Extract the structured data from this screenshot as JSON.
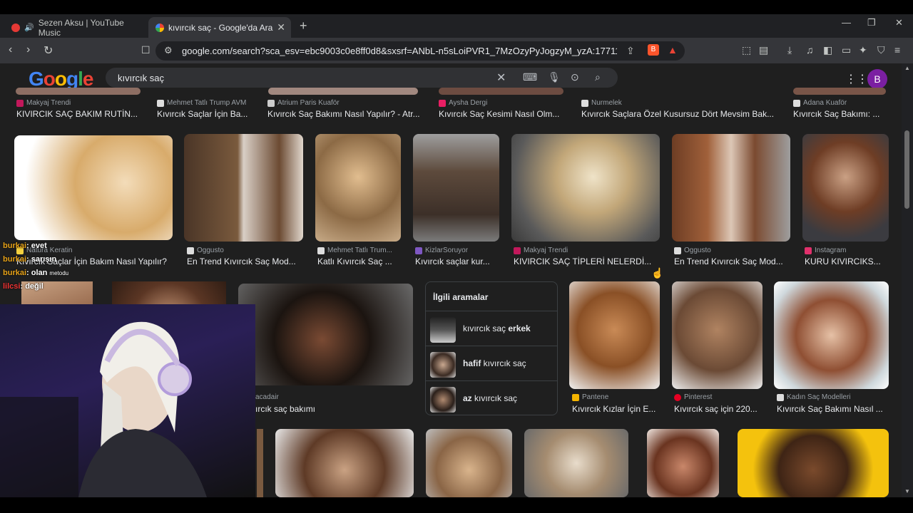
{
  "tabs": [
    {
      "label": "Sezen Aksu | YouTube Music",
      "active": false
    },
    {
      "label": "kıvırcık saç - Google'da Ara",
      "active": true
    }
  ],
  "address": {
    "url": "google.com/search?sca_esv=ebc9003c0e8ff0d8&sxsrf=ANbL-n5sLoiPVR1_7MzOzyPyJogzyM_yzA:1771197863048&u..."
  },
  "search": {
    "query": "kıvırcık saç",
    "logo": "Google"
  },
  "account": {
    "initial": "B"
  },
  "row1": [
    {
      "source": "Makyaj Trendi",
      "title": "KIVIRCIK SAÇ BAKIM RUTİN...",
      "fav": "#c2185b"
    },
    {
      "source": "Mehmet Tatlı Trump AVM",
      "title": "Kıvırcık Saçlar İçin Ba...",
      "fav": "#ddd"
    },
    {
      "source": "Atrium Paris Kuaför",
      "title": "Kıvırcık Saç Bakımı Nasıl Yapılır? - Atr...",
      "fav": "#ccc"
    },
    {
      "source": "Aysha Dergi",
      "title": "Kıvırcık Saç Kesimi Nasıl Olm...",
      "fav": "#e91e63"
    },
    {
      "source": "Nurmelek",
      "title": "Kıvırcık Saçlara Özel Kusursuz Dört Mevsim Bak...",
      "fav": "#ddd"
    },
    {
      "source": "Adana Kuaför",
      "title": "Kıvırcık Saç Bakımı: ...",
      "fav": "#ddd"
    }
  ],
  "row2": [
    {
      "source": "Natura Keratin",
      "title": "Kıvırcık Saçlar İçin Bakım Nasıl Yapılır?",
      "fav": "#f4d03f"
    },
    {
      "source": "Oggusto",
      "title": "En Trend Kıvırcık Saç Mod...",
      "fav": "#ddd"
    },
    {
      "source": "Mehmet Tatlı Trum...",
      "title": "Katlı Kıvırcık Saç ...",
      "fav": "#ddd"
    },
    {
      "source": "KizlarSoruyor",
      "title": "Kıvırcık saçlar kur...",
      "fav": "#7e57c2"
    },
    {
      "source": "Makyaj Trendi",
      "title": "KIVIRCIK SAÇ TİPLERİ NELERDİ...",
      "fav": "#c2185b"
    },
    {
      "source": "Oggusto",
      "title": "En Trend Kıvırcık Saç Mod...",
      "fav": "#ddd"
    },
    {
      "source": "Instagram",
      "title": "KURU KIVIRCIKS...",
      "fav": "#e1306c"
    }
  ],
  "row3": [
    {
      "source": "acadair",
      "title": "ırcık saç bakımı",
      "fav": "#888"
    },
    {
      "source": "Pantene",
      "title": "Kıvırcık Kızlar İçin E...",
      "fav": "#f4b400"
    },
    {
      "source": "Pinterest",
      "title": "Kıvırcık saç için 220...",
      "fav": "#e60023"
    },
    {
      "source": "Kadın Saç Modelleri",
      "title": "Kıvırcık Saç Bakımı Nasıl ...",
      "fav": "#ddd"
    }
  ],
  "related": {
    "heading": "İlgili aramalar",
    "items": [
      {
        "plain": "kıvırcık saç ",
        "bold": "erkek",
        "bold_first": false
      },
      {
        "plain": " kıvırcık saç",
        "bold": "hafif",
        "bold_first": true
      },
      {
        "plain": " kıvırcık saç",
        "bold": "az",
        "bold_first": true
      }
    ]
  },
  "chat": [
    {
      "user": "burkai",
      "msg": ": evet"
    },
    {
      "user": "burkai",
      "msg": ": sarışın"
    },
    {
      "user": "burkai",
      "msg": ": olan",
      "extra": "metodu"
    },
    {
      "user": "lilcsi",
      "msg": ": değil"
    }
  ]
}
